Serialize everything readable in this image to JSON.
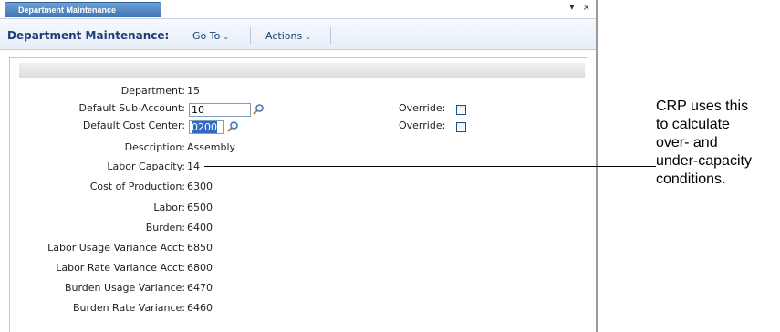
{
  "window": {
    "tab_label": "Department Maintenance",
    "controls": {
      "dropdown": "▾",
      "close": "×"
    }
  },
  "toolbar": {
    "title": "Department Maintenance:",
    "menus": [
      "Go To",
      "Actions"
    ]
  },
  "form": {
    "department": {
      "label": "Department:",
      "value": "15"
    },
    "default_sub_account": {
      "label": "Default Sub-Account:",
      "value": "10",
      "override_label": "Override:",
      "override_checked": false
    },
    "default_cost_center": {
      "label": "Default Cost Center:",
      "value": "0200",
      "override_label": "Override:",
      "override_checked": false
    },
    "description": {
      "label": "Description:",
      "value": "Assembly"
    },
    "labor_capacity": {
      "label": "Labor Capacity:",
      "value": "14"
    },
    "cost_of_production": {
      "label": "Cost of Production:",
      "value": "6300"
    },
    "labor": {
      "label": "Labor:",
      "value": "6500"
    },
    "burden": {
      "label": "Burden:",
      "value": "6400"
    },
    "labor_usage_variance": {
      "label": "Labor Usage Variance Acct:",
      "value": "6850"
    },
    "labor_rate_variance": {
      "label": "Labor Rate Variance Acct:",
      "value": "6800"
    },
    "burden_usage_variance": {
      "label": "Burden Usage Variance:",
      "value": "6470"
    },
    "burden_rate_variance": {
      "label": "Burden Rate Variance:",
      "value": "6460"
    }
  },
  "callout": {
    "lines": [
      "CRP uses this",
      "to calculate",
      "over- and",
      "under-capacity",
      "conditions."
    ]
  },
  "colors": {
    "accent": "#3e73b4",
    "title_text": "#1d3f74",
    "selection": "#316ac5"
  }
}
